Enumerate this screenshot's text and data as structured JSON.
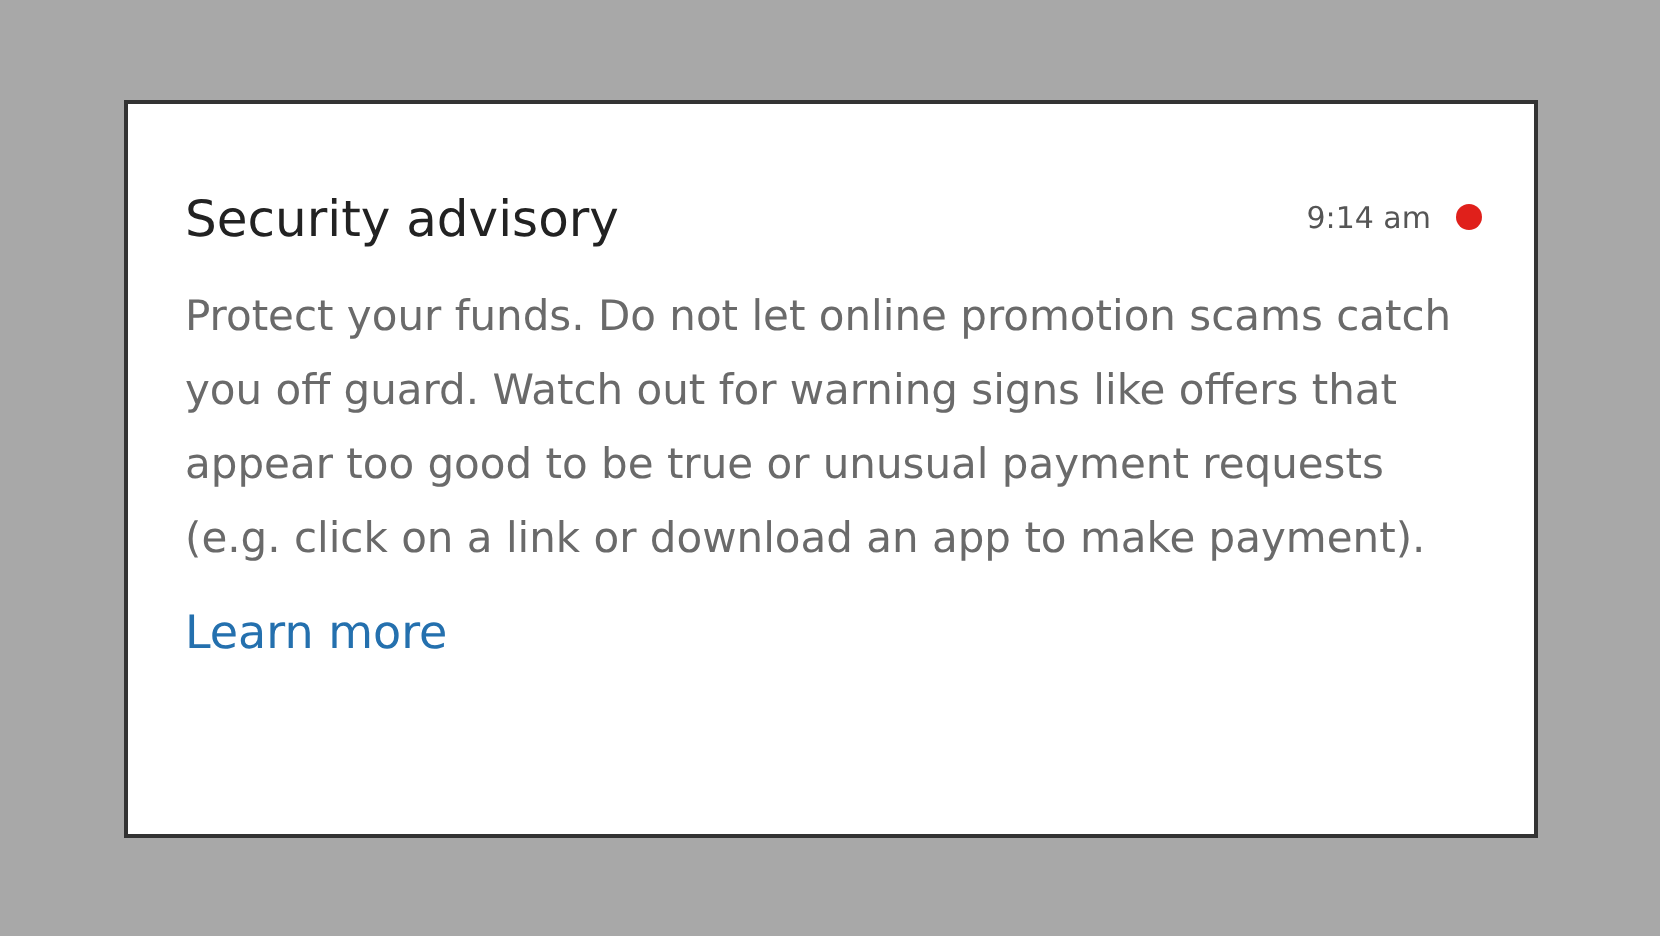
{
  "notification": {
    "title": "Security advisory",
    "time": "9:14 am",
    "unread": true,
    "body": "Protect your funds. Do not let online promotion scams catch you off guard. Watch out for warning signs like offers that appear too good to be true or unusual payment requests (e.g. click on a link or download an app to make payment).",
    "link": "Learn more"
  }
}
